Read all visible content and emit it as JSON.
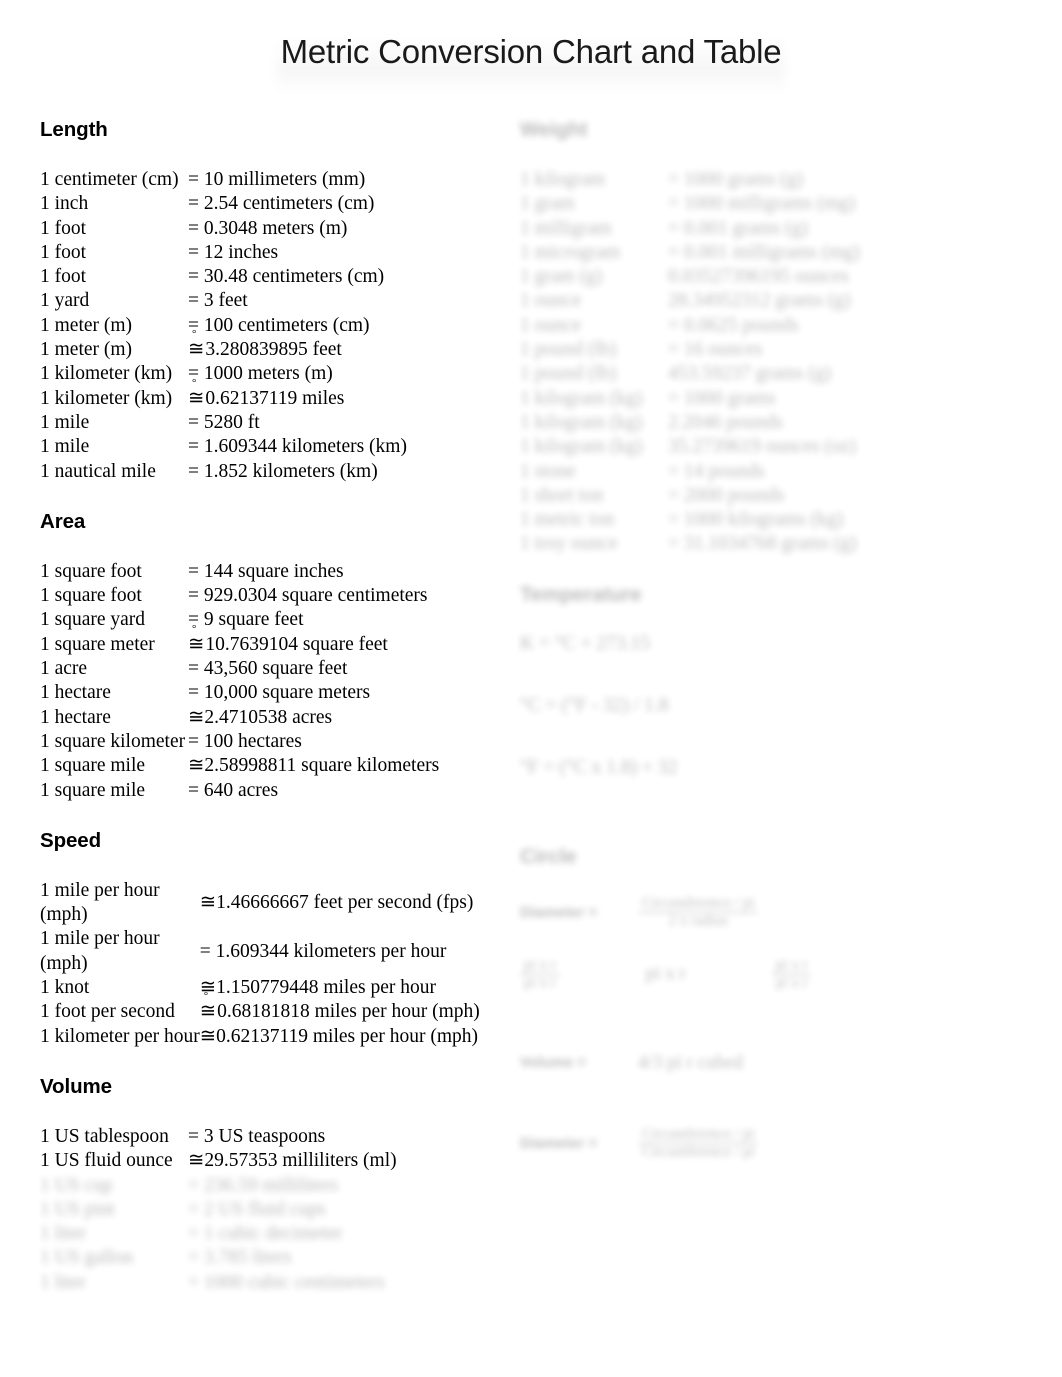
{
  "document": {
    "title": "Metric Conversion Chart and Table"
  },
  "left_column": {
    "sections": [
      {
        "heading": "Length",
        "rows": [
          {
            "unit": "1 centimeter (cm)",
            "value": "= 10 millimeters (mm)",
            "approx": false,
            "tall": true
          },
          {
            "unit": "1 inch",
            "value": "= 2.54 centimeters (cm)",
            "approx": false,
            "tall": false
          },
          {
            "unit": "1 foot",
            "value": "= 0.3048 meters (m)",
            "approx": false,
            "tall": false
          },
          {
            "unit": "1 foot",
            "value": "= 12 inches",
            "approx": false,
            "tall": false
          },
          {
            "unit": "1 foot",
            "value": "= 30.48 centimeters (cm)",
            "approx": false,
            "tall": false
          },
          {
            "unit": "1 yard",
            "value": "= 3 feet",
            "approx": false,
            "tall": false
          },
          {
            "unit": "1 meter (m)",
            "value": "= 100 centimeters (cm)",
            "approx": false,
            "tall": false
          },
          {
            "unit": "1 meter (m)",
            "value": "3.280839895 feet",
            "approx": true,
            "tall": false
          },
          {
            "unit": "1 kilometer (km)",
            "value": "= 1000 meters (m)",
            "approx": false,
            "tall": false
          },
          {
            "unit": "1 kilometer (km)",
            "value": "0.62137119 miles",
            "approx": true,
            "tall": false
          },
          {
            "unit": "1 mile",
            "value": "= 5280 ft",
            "approx": false,
            "tall": false
          },
          {
            "unit": "1 mile",
            "value": "= 1.609344 kilometers (km)",
            "approx": false,
            "tall": false
          },
          {
            "unit": "1 nautical mile",
            "value": "= 1.852 kilometers (km)",
            "approx": false,
            "tall": false
          }
        ]
      },
      {
        "heading": "Area",
        "rows": [
          {
            "unit": "1 square foot",
            "value": "= 144 square inches",
            "approx": false,
            "tall": false
          },
          {
            "unit": "1 square foot",
            "value": "= 929.0304 square centimeters",
            "approx": false,
            "tall": false
          },
          {
            "unit": "1 square yard",
            "value": "= 9 square feet",
            "approx": false,
            "tall": false
          },
          {
            "unit": "1 square meter",
            "value": "10.7639104 square feet",
            "approx": true,
            "tall": false
          },
          {
            "unit": "1 acre",
            "value": "= 43,560 square feet",
            "approx": false,
            "tall": false
          },
          {
            "unit": "1 hectare",
            "value": "= 10,000 square meters",
            "approx": false,
            "tall": false
          },
          {
            "unit": "1 hectare",
            "value": "2.4710538 acres",
            "approx": true,
            "tall": false
          },
          {
            "unit": "1 square kilometer",
            "value": "= 100 hectares",
            "approx": false,
            "tall": false
          },
          {
            "unit": "1 square mile",
            "value": "2.58998811 square kilometers",
            "approx": true,
            "tall": false
          },
          {
            "unit": "1 square mile",
            "value": "= 640 acres",
            "approx": false,
            "tall": false
          }
        ]
      },
      {
        "heading": "Speed",
        "rows": [
          {
            "unit": "1 mile per hour (mph)",
            "value": "1.46666667 feet per second (fps)",
            "approx": true,
            "tall": true
          },
          {
            "unit": "1 mile per hour (mph)",
            "value": "= 1.609344 kilometers per hour",
            "approx": false,
            "tall": true
          },
          {
            "unit": "1 knot",
            "value": "1.150779448 miles per hour",
            "approx": true,
            "tall": false
          },
          {
            "unit": "1 foot per second",
            "value": "0.68181818 miles per hour (mph)",
            "approx": true,
            "tall": false
          },
          {
            "unit": "1 kilometer per hour",
            "value": "0.62137119 miles per hour (mph)",
            "approx": true,
            "tall": false
          }
        ]
      },
      {
        "heading": "Volume",
        "rows": [
          {
            "unit": "1 US tablespoon",
            "value": "= 3 US teaspoons",
            "approx": false,
            "tall": false
          },
          {
            "unit": "1 US fluid ounce",
            "value": "29.57353 milliliters (ml)",
            "approx": true,
            "tall": true
          }
        ],
        "obscured_rows": [
          {
            "unit": "1 US cup",
            "value": "= 236.59 milliliters"
          },
          {
            "unit": "1 US pint",
            "value": "= 2 US fluid cups"
          },
          {
            "unit": "1 liter",
            "value": "= 1 cubic decimeter"
          },
          {
            "unit": "1 US gallon",
            "value": "= 3.785 liters"
          },
          {
            "unit": "1 liter",
            "value": "= 1000 cubic centimeters"
          }
        ]
      }
    ]
  },
  "right_column": {
    "obscured": true,
    "sections": [
      {
        "heading": "Weight",
        "rows": [
          {
            "unit": "1 kilogram",
            "value": "= 1000 grams (g)"
          },
          {
            "unit": "1 gram",
            "value": "= 1000 milligrams (mg)"
          },
          {
            "unit": "1 milligram",
            "value": "= 0.001 grams (g)"
          },
          {
            "unit": "1 microgram",
            "value": "= 0.001 milligrams (mg)"
          },
          {
            "unit": "1 gram (g)",
            "value": "0.03527396195 ounces"
          },
          {
            "unit": "1 ounce",
            "value": "28.34952312 grams (g)"
          },
          {
            "unit": "1 ounce",
            "value": "= 0.0625 pounds"
          },
          {
            "unit": "1 pound (lb)",
            "value": "= 16 ounces"
          },
          {
            "unit": "1 pound (lb)",
            "value": "453.59237 grams (g)"
          },
          {
            "unit": "1 kilogram (kg)",
            "value": "= 1000 grams"
          },
          {
            "unit": "1 kilogram (kg)",
            "value": "2.2046 pounds"
          },
          {
            "unit": "1 kilogram (kg)",
            "value": "35.2739619 ounces (oz)"
          },
          {
            "unit": "1 stone",
            "value": "= 14 pounds"
          },
          {
            "unit": "1 short ton",
            "value": "= 2000 pounds"
          },
          {
            "unit": "1 metric ton",
            "value": "= 1000 kilograms (kg)"
          },
          {
            "unit": "1 troy ounce",
            "value": "= 31.1034768 grams (g)"
          }
        ]
      },
      {
        "heading": "Temperature",
        "formulas": [
          "K = °C + 273.15",
          "°C = (°F - 32) / 1.8",
          "°F = (°C x 1.8) + 32"
        ]
      },
      {
        "heading": "Circle",
        "formulas": [
          {
            "label": "Diameter =",
            "body": "2 x radius",
            "note": "Circumference / pi"
          },
          {
            "label": "",
            "body": "pi x r",
            "note": ""
          },
          {
            "label": "Volume =",
            "body": "4/3 pi r cubed",
            "note": ""
          },
          {
            "label": "Diameter =",
            "body": "Circumference / pi",
            "note": ""
          }
        ]
      }
    ]
  }
}
